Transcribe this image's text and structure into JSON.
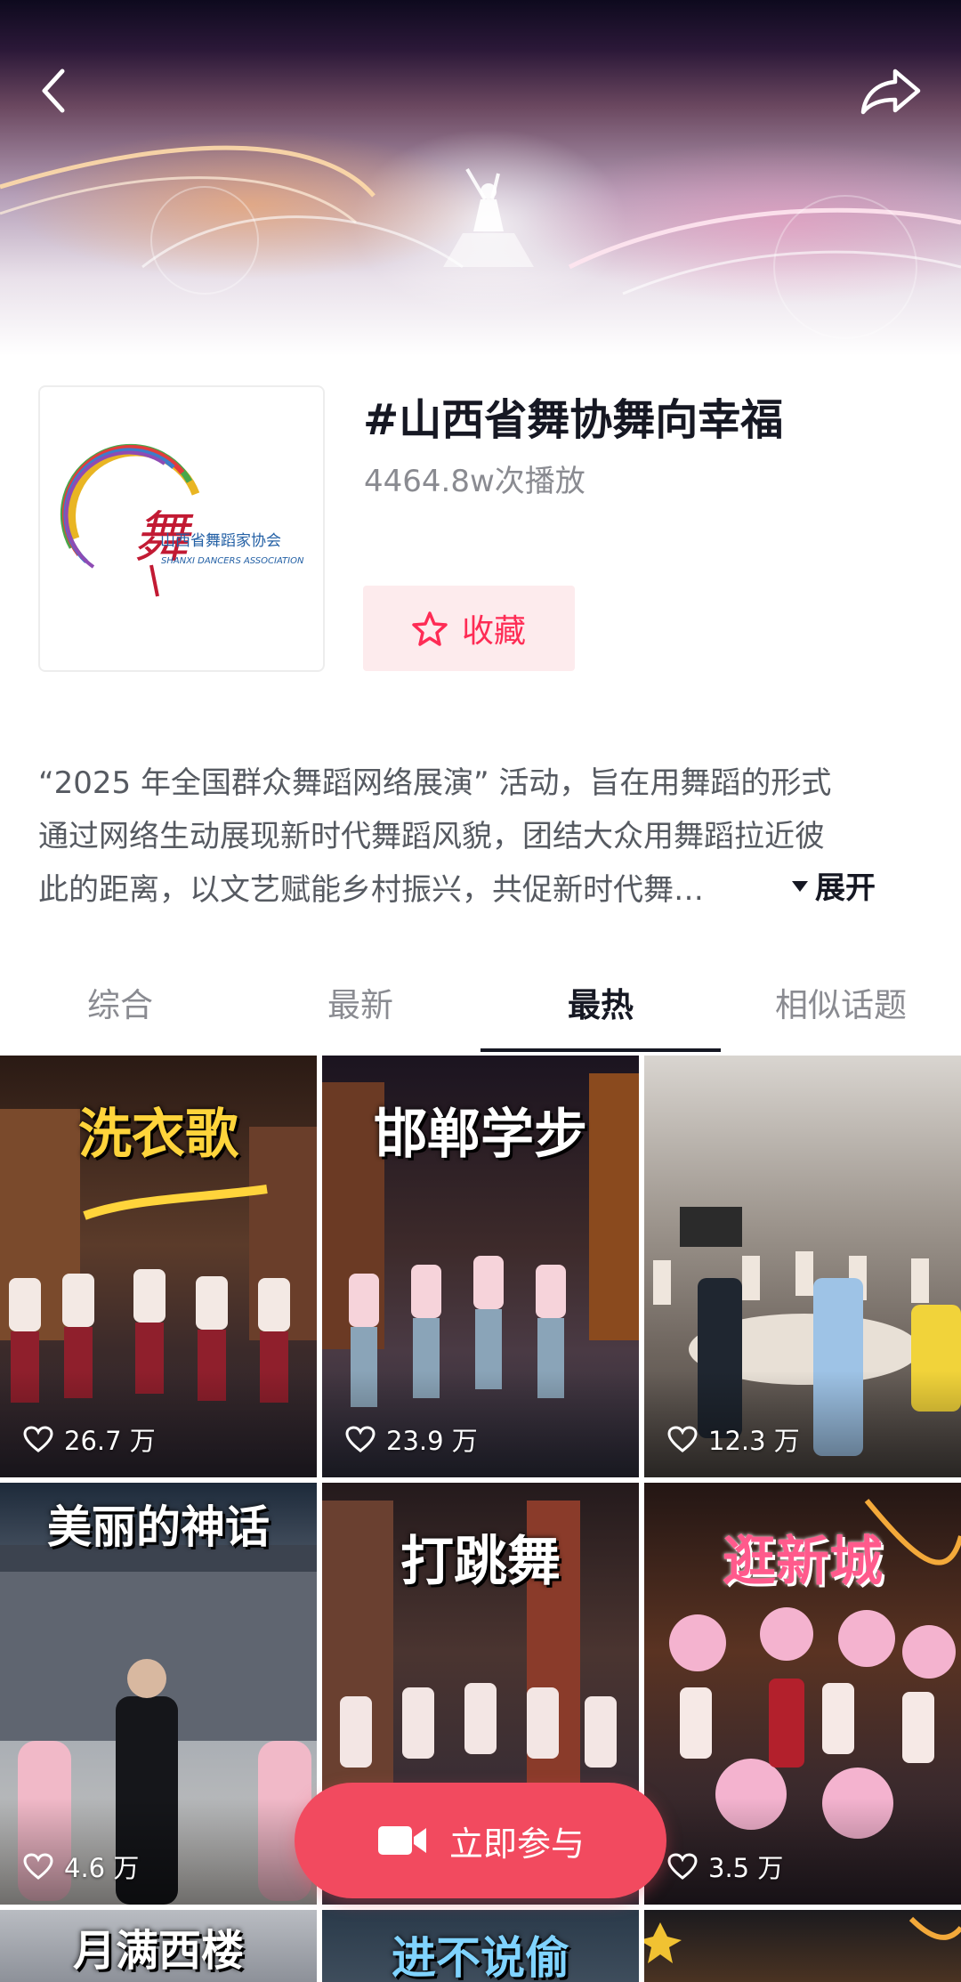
{
  "header": {
    "back_icon": "chevron-left-icon",
    "share_icon": "share-arrow-icon"
  },
  "topic": {
    "title": "#山西省舞协舞向幸福",
    "plays": "4464.8w次播放",
    "favorite_label": "收藏",
    "logo_text_cn": "山西省舞蹈家协会",
    "logo_text_en": "SHANXI DANCERS ASSOCIATION"
  },
  "description": {
    "lines": [
      "“2025 年全国群众舞蹈网络展演” 活动，旨在用舞蹈的形式",
      "通过网络生动展现新时代舞蹈风貌，团结大众用舞蹈拉近彼",
      "此的距离，以文艺赋能乡村振兴，共促新时代舞…"
    ],
    "expand_label": "展开"
  },
  "tabs": [
    {
      "label": "综合",
      "active": false
    },
    {
      "label": "最新",
      "active": false
    },
    {
      "label": "最热",
      "active": true
    },
    {
      "label": "相似话题",
      "active": false
    }
  ],
  "videos": [
    {
      "overlay": "洗衣歌",
      "likes": "26.7 万"
    },
    {
      "overlay": "邯郸学步",
      "likes": "23.9 万"
    },
    {
      "overlay": "",
      "likes": "12.3 万"
    },
    {
      "overlay": "美丽的神话",
      "likes": "4.6 万"
    },
    {
      "overlay": "打跳舞",
      "likes": ""
    },
    {
      "overlay": "逛新城",
      "likes": "3.5 万"
    },
    {
      "overlay": "月满西楼",
      "likes": ""
    },
    {
      "overlay": "进不说偷",
      "likes": ""
    },
    {
      "overlay": "",
      "likes": ""
    }
  ],
  "cta": {
    "label": "立即参与",
    "icon": "video-camera-icon"
  },
  "colors": {
    "accent": "#fe2c55",
    "cta_bg": "#f24a5f",
    "fav_bg": "#fdebed",
    "text_primary": "#161823",
    "text_secondary": "#8a8b91"
  }
}
